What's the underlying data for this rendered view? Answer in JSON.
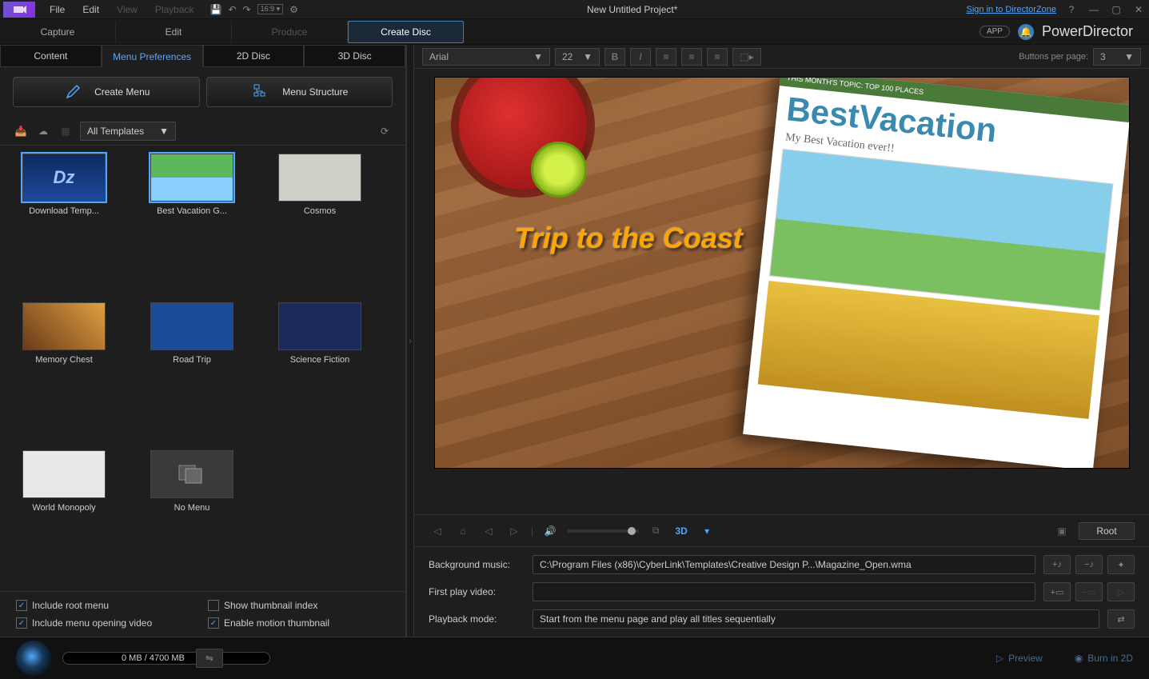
{
  "titlebar": {
    "menus": [
      "File",
      "Edit",
      "View",
      "Playback"
    ],
    "disabled_menus": [
      "View",
      "Playback"
    ],
    "title": "New Untitled Project*",
    "signin": "Sign in to DirectorZone"
  },
  "app": {
    "pill": "APP",
    "product": "PowerDirector"
  },
  "mode_tabs": {
    "capture": "Capture",
    "edit": "Edit",
    "produce": "Produce",
    "create_disc": "Create Disc"
  },
  "subtabs": {
    "content": "Content",
    "menu_prefs": "Menu Preferences",
    "disc_2d": "2D Disc",
    "disc_3d": "3D Disc"
  },
  "actions": {
    "create_menu": "Create Menu",
    "menu_structure": "Menu Structure"
  },
  "filter": {
    "select": "All Templates"
  },
  "templates": [
    {
      "id": "dz",
      "label": "Download Temp...",
      "selected": true
    },
    {
      "id": "vac",
      "label": "Best Vacation G...",
      "selected": true
    },
    {
      "id": "cosmos",
      "label": "Cosmos"
    },
    {
      "id": "mem",
      "label": "Memory Chest"
    },
    {
      "id": "road",
      "label": "Road Trip"
    },
    {
      "id": "sci",
      "label": "Science Fiction"
    },
    {
      "id": "world",
      "label": "World Monopoly"
    },
    {
      "id": "none",
      "label": "No Menu"
    }
  ],
  "checkboxes": {
    "root": "Include root menu",
    "thumb_index": "Show thumbnail index",
    "opening": "Include menu opening video",
    "motion": "Enable motion thumbnail"
  },
  "text_toolbar": {
    "font": "Arial",
    "size": "22",
    "buttons_per_page_label": "Buttons per page:",
    "buttons_per_page": "3"
  },
  "preview": {
    "title_text": "Trip to the Coast",
    "mag_head": "THIS MONTH'S TOPIC: TOP 100 PLACES",
    "mag_title": "BestVacation",
    "mag_sub": "My Best Vacation ever!!"
  },
  "playback": {
    "root_btn": "Root",
    "threed": "3D"
  },
  "props": {
    "bg_music_label": "Background music:",
    "bg_music": "C:\\Program Files (x86)\\CyberLink\\Templates\\Creative Design P...\\Magazine_Open.wma",
    "first_play_label": "First play video:",
    "first_play": "",
    "playback_mode_label": "Playback mode:",
    "playback_mode": "Start from the menu page and play all titles sequentially"
  },
  "bottom": {
    "capacity": "0 MB / 4700 MB",
    "preview": "Preview",
    "burn": "Burn in 2D"
  }
}
